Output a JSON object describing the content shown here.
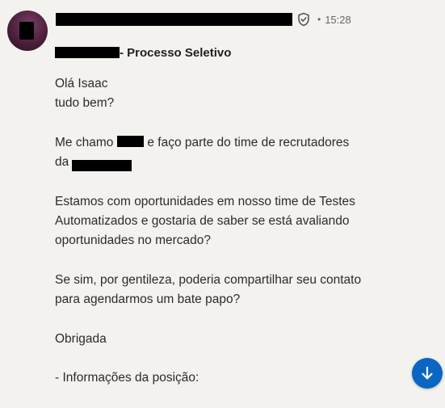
{
  "message": {
    "timestamp": "15:28",
    "separator_dot": "•",
    "subject": "- Processo Seletivo",
    "body": {
      "greeting_line1": "Olá Isaac",
      "greeting_line2": "tudo bem?",
      "intro_part1": "Me chamo",
      "intro_part2": "e faço parte do time de recrutadores",
      "intro_line2_prefix": "da",
      "para3_line1": "Estamos com oportunidades em nosso time de Testes",
      "para3_line2": "Automatizados e gostaria de saber se está avaliando",
      "para3_line3": "oportunidades no mercado?",
      "para4_line1": "Se sim, por gentileza, poderia compartilhar seu contato",
      "para4_line2": "para agendarmos um bate papo?",
      "sign_off": "Obrigada",
      "position_info": "- Informações da posição:"
    }
  },
  "icons": {
    "verified": "shield-check-icon",
    "scroll_down": "arrow-down-icon"
  },
  "colors": {
    "background": "#f3f2ef",
    "scroll_button": "#0a66c2",
    "meta_text": "#666666"
  }
}
